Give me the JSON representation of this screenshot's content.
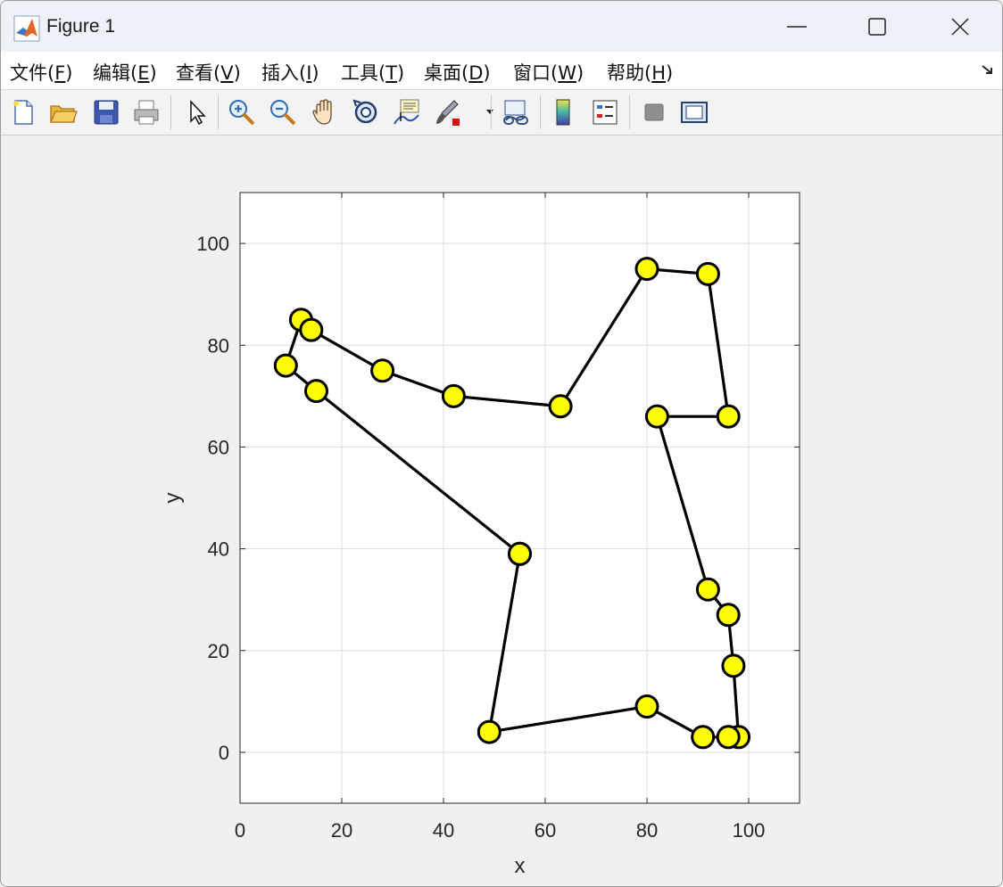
{
  "window": {
    "title": "Figure 1"
  },
  "menu": {
    "items": [
      {
        "label": "文件(",
        "key": "F",
        "tail": ")"
      },
      {
        "label": "编辑(",
        "key": "E",
        "tail": ")"
      },
      {
        "label": "查看(",
        "key": "V",
        "tail": ")"
      },
      {
        "label": "插入(",
        "key": "I",
        "tail": ")"
      },
      {
        "label": "工具(",
        "key": "T",
        "tail": ")"
      },
      {
        "label": "桌面(",
        "key": "D",
        "tail": ")"
      },
      {
        "label": "窗口(",
        "key": "W",
        "tail": ")"
      },
      {
        "label": "帮助(",
        "key": "H",
        "tail": ")"
      }
    ]
  },
  "toolbar": {
    "tools": [
      "new-figure-icon",
      "open-folder-icon",
      "save-icon",
      "print-icon",
      "select-arrow-icon",
      "zoom-in-icon",
      "zoom-out-icon",
      "pan-hand-icon",
      "rotate-3d-icon",
      "data-tips-icon",
      "brush-icon",
      "link-plot-icon",
      "colorbar-icon",
      "legend-icon",
      "hide-plot-tools-icon",
      "show-plot-tools-icon"
    ]
  },
  "chart_data": {
    "type": "line",
    "xlabel": "x",
    "ylabel": "y",
    "xlim": [
      0,
      110
    ],
    "ylim": [
      -10,
      110
    ],
    "xticks": [
      0,
      20,
      40,
      60,
      80,
      100
    ],
    "yticks": [
      0,
      20,
      40,
      60,
      80,
      100
    ],
    "grid": true,
    "marker": "circle",
    "marker_face_color": "#ffff00",
    "marker_edge_color": "#000000",
    "line_color": "#000000",
    "series": [
      {
        "x": [
          55,
          15,
          9,
          12,
          14,
          28,
          42,
          63,
          80,
          92,
          96,
          82,
          92,
          96,
          97,
          98,
          96,
          91,
          80,
          49,
          55
        ],
        "y": [
          39,
          71,
          76,
          85,
          83,
          75,
          70,
          68,
          95,
          94,
          66,
          66,
          32,
          27,
          17,
          3,
          3,
          3,
          9,
          4,
          39
        ]
      }
    ]
  }
}
